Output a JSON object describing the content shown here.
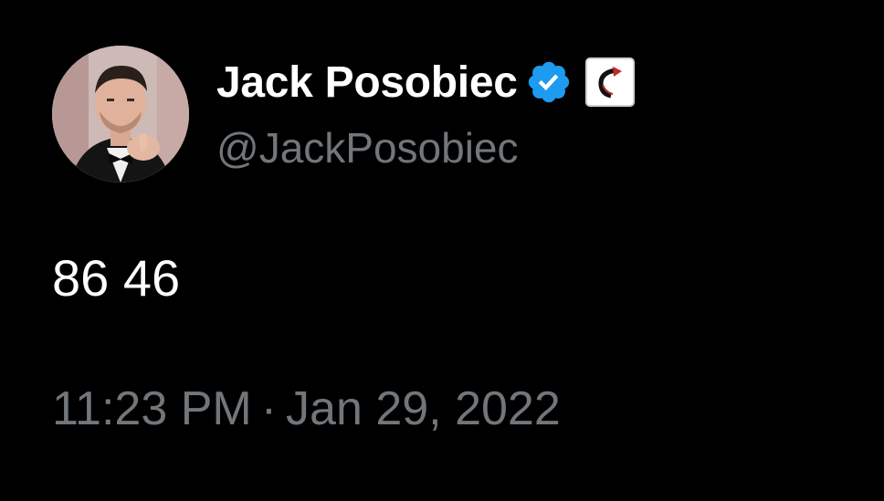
{
  "author": {
    "display_name": "Jack Posobiec",
    "handle": "@JackPosobiec",
    "verified_icon": "verified-badge-icon",
    "affiliate_icon": "affiliate-logo-icon",
    "badge_color": "#1d9bf0"
  },
  "tweet": {
    "text": "86 46",
    "time": "11:23 PM",
    "separator": "·",
    "date": "Jan 29, 2022"
  },
  "colors": {
    "background": "#000000",
    "primary_text": "#ffffff",
    "secondary_text": "#71767b"
  }
}
